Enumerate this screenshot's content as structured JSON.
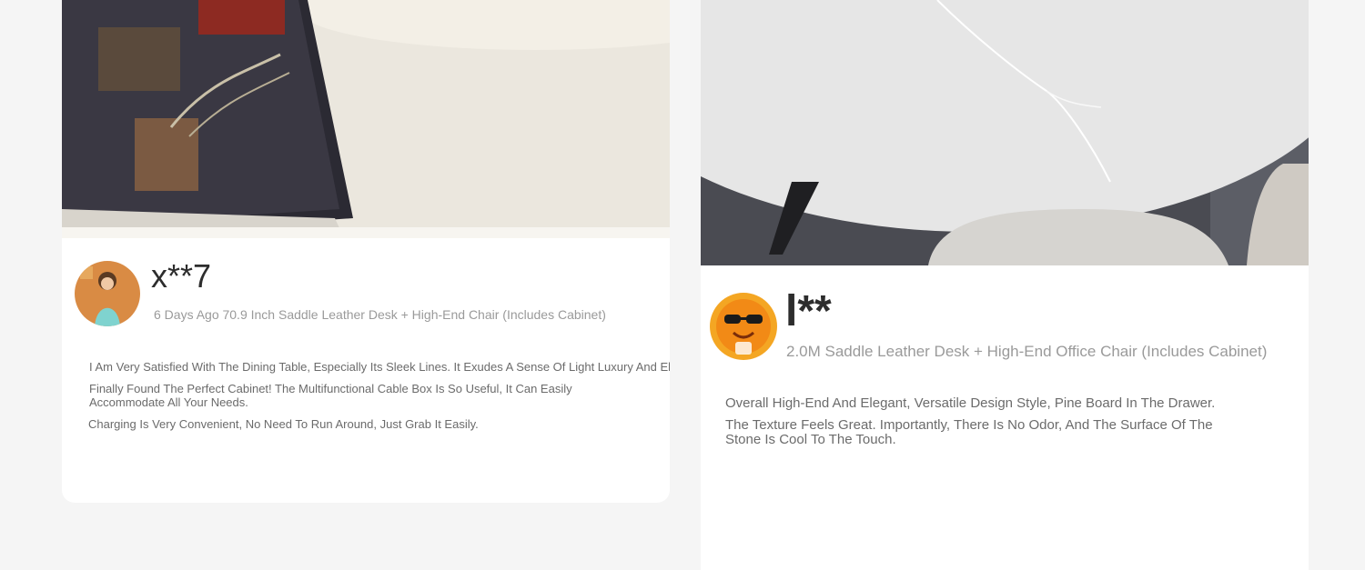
{
  "reviews": [
    {
      "user": "x**7",
      "meta": "6 Days Ago 70.9 Inch Saddle Leather Desk + High-End Chair (Includes Cabinet)",
      "lines": [
        "I Am Very Satisfied With The Dining Table, Especially Its Sleek Lines. It Exudes A Sense Of Light Luxury And Elegance.",
        "Finally Found The Perfect Cabinet! The Multifunctional Cable Box Is So Useful, It Can Easily Accommodate All Your Needs.",
        "Charging Is Very Convenient, No Need To Run Around, Just Grab It Easily."
      ]
    },
    {
      "user": "l**",
      "meta": "2.0M Saddle Leather Desk + High-End Office Chair (Includes Cabinet)",
      "lines": [
        "Overall High-End And Elegant, Versatile Design Style, Pine Board In The Drawer.",
        "The Texture Feels Great. Importantly, There Is No Odor, And The Surface Of The Stone Is Cool To The Touch."
      ]
    }
  ]
}
